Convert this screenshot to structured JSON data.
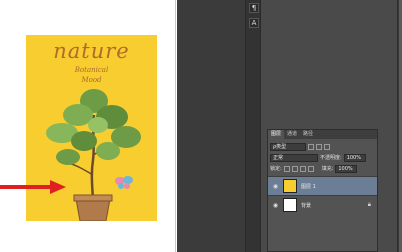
{
  "poster": {
    "title": "nature",
    "subtitle_line1": "Botanical",
    "subtitle_line2": "Mood"
  },
  "toolbar": {
    "tool1": "¶",
    "tool2": "A"
  },
  "layers_panel": {
    "tabs": [
      "图层",
      "通道",
      "路径"
    ],
    "filter_label": "ρ类型",
    "blend_mode": "正常",
    "opacity_label": "不透明度:",
    "opacity_value": "100%",
    "lock_label": "锁定:",
    "fill_label": "填充:",
    "fill_value": "100%",
    "layers": [
      {
        "name": "图层 1",
        "selected": true,
        "visible": true
      },
      {
        "name": "背景",
        "selected": false,
        "visible": true,
        "locked": true
      }
    ]
  },
  "colors": {
    "poster_bg": "#f7cd2f",
    "arrow": "#e02020",
    "selected_layer": "#6b7e95"
  }
}
